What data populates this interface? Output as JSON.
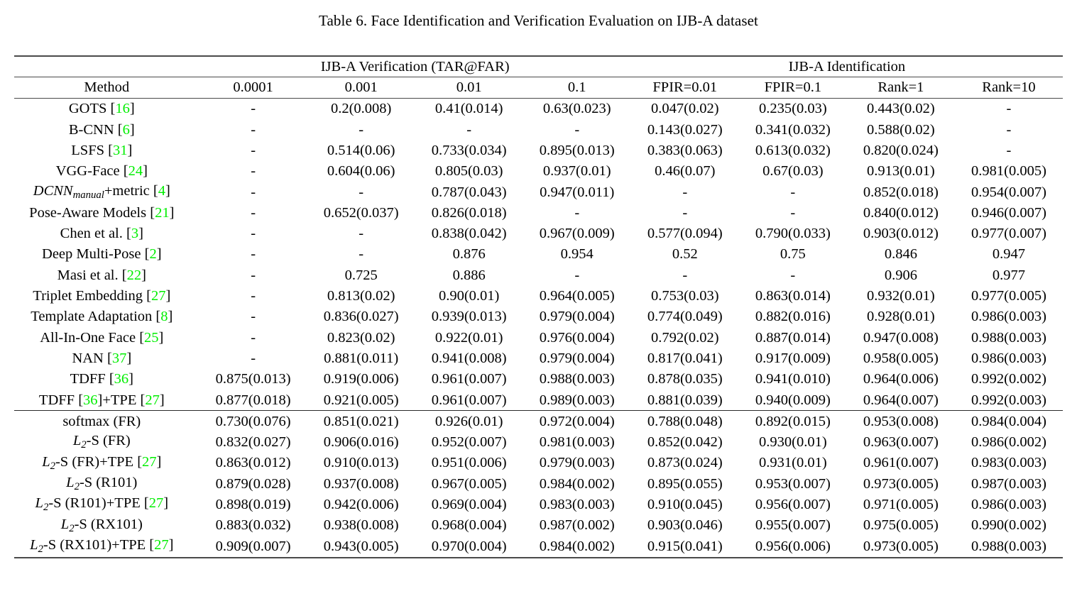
{
  "caption": "Table 6. Face Identification and Verification Evaluation on IJB-A dataset",
  "groups": {
    "verification": "IJB-A Verification (TAR@FAR)",
    "identification": "IJB-A Identification"
  },
  "columns": {
    "method": "Method",
    "far_0001": "0.0001",
    "far_001": "0.001",
    "far_01": "0.01",
    "far_1": "0.1",
    "fpir_001": "FPIR=0.01",
    "fpir_01": "FPIR=0.1",
    "rank1": "Rank=1",
    "rank10": "Rank=10"
  },
  "colors": {
    "citation_green": "#00ee00",
    "rule": "#3a3a3a",
    "text": "#000000"
  },
  "sections": [
    {
      "name": "prior-work",
      "rows": [
        {
          "method_parts": [
            {
              "t": "GOTS ",
              "k": "plain"
            },
            {
              "t": "[",
              "k": "br"
            },
            {
              "t": "16",
              "k": "cite"
            },
            {
              "t": "]",
              "k": "br"
            }
          ],
          "method_text": "GOTS [16]",
          "cells": [
            "-",
            "0.2(0.008)",
            "0.41(0.014)",
            "0.63(0.023)",
            "0.047(0.02)",
            "0.235(0.03)",
            "0.443(0.02)",
            "-"
          ],
          "bold": [
            false,
            false,
            false,
            false,
            false,
            false,
            false,
            false
          ]
        },
        {
          "method_parts": [
            {
              "t": "B-CNN ",
              "k": "plain"
            },
            {
              "t": "[",
              "k": "br"
            },
            {
              "t": "6",
              "k": "cite"
            },
            {
              "t": "]",
              "k": "br"
            }
          ],
          "method_text": "B-CNN [6]",
          "cells": [
            "-",
            "-",
            "-",
            "-",
            "0.143(0.027)",
            "0.341(0.032)",
            "0.588(0.02)",
            "-"
          ],
          "bold": [
            false,
            false,
            false,
            false,
            false,
            false,
            false,
            false
          ]
        },
        {
          "method_parts": [
            {
              "t": "LSFS ",
              "k": "plain"
            },
            {
              "t": "[",
              "k": "br"
            },
            {
              "t": "31",
              "k": "cite"
            },
            {
              "t": "]",
              "k": "br"
            }
          ],
          "method_text": "LSFS [31]",
          "cells": [
            "-",
            "0.514(0.06)",
            "0.733(0.034)",
            "0.895(0.013)",
            "0.383(0.063)",
            "0.613(0.032)",
            "0.820(0.024)",
            "-"
          ],
          "bold": [
            false,
            false,
            false,
            false,
            false,
            false,
            false,
            false
          ]
        },
        {
          "method_parts": [
            {
              "t": "VGG-Face ",
              "k": "plain"
            },
            {
              "t": "[",
              "k": "br"
            },
            {
              "t": "24",
              "k": "cite"
            },
            {
              "t": "]",
              "k": "br"
            }
          ],
          "method_text": "VGG-Face [24]",
          "cells": [
            "-",
            "0.604(0.06)",
            "0.805(0.03)",
            "0.937(0.01)",
            "0.46(0.07)",
            "0.67(0.03)",
            "0.913(0.01)",
            "0.981(0.005)"
          ],
          "bold": [
            false,
            false,
            false,
            false,
            false,
            false,
            false,
            false
          ]
        },
        {
          "method_parts": [
            {
              "t": "DCNN",
              "k": "mi"
            },
            {
              "t": "manual",
              "k": "sub"
            },
            {
              "t": "+metric ",
              "k": "plain"
            },
            {
              "t": "[",
              "k": "br"
            },
            {
              "t": "4",
              "k": "cite"
            },
            {
              "t": "]",
              "k": "br"
            }
          ],
          "method_text": "DCNN_manual+metric [4]",
          "cells": [
            "-",
            "-",
            "0.787(0.043)",
            "0.947(0.011)",
            "-",
            "-",
            "0.852(0.018)",
            "0.954(0.007)"
          ],
          "bold": [
            false,
            false,
            false,
            false,
            false,
            false,
            false,
            false
          ]
        },
        {
          "method_parts": [
            {
              "t": "Pose-Aware Models ",
              "k": "plain"
            },
            {
              "t": "[",
              "k": "br"
            },
            {
              "t": "21",
              "k": "cite"
            },
            {
              "t": "]",
              "k": "br"
            }
          ],
          "method_text": "Pose-Aware Models [21]",
          "cells": [
            "-",
            "0.652(0.037)",
            "0.826(0.018)",
            "-",
            "-",
            "-",
            "0.840(0.012)",
            "0.946(0.007)"
          ],
          "bold": [
            false,
            false,
            false,
            false,
            false,
            false,
            false,
            false
          ]
        },
        {
          "method_parts": [
            {
              "t": "Chen et al. ",
              "k": "plain"
            },
            {
              "t": "[",
              "k": "br"
            },
            {
              "t": "3",
              "k": "cite"
            },
            {
              "t": "]",
              "k": "br"
            }
          ],
          "method_text": "Chen et al. [3]",
          "cells": [
            "-",
            "-",
            "0.838(0.042)",
            "0.967(0.009)",
            "0.577(0.094)",
            "0.790(0.033)",
            "0.903(0.012)",
            "0.977(0.007)"
          ],
          "bold": [
            false,
            false,
            false,
            false,
            false,
            false,
            false,
            false
          ]
        },
        {
          "method_parts": [
            {
              "t": "Deep Multi-Pose ",
              "k": "plain"
            },
            {
              "t": "[",
              "k": "br"
            },
            {
              "t": "2",
              "k": "cite"
            },
            {
              "t": "]",
              "k": "br"
            }
          ],
          "method_text": "Deep Multi-Pose [2]",
          "cells": [
            "-",
            "-",
            "0.876",
            "0.954",
            "0.52",
            "0.75",
            "0.846",
            "0.947"
          ],
          "bold": [
            false,
            false,
            false,
            false,
            false,
            false,
            false,
            false
          ]
        },
        {
          "method_parts": [
            {
              "t": "Masi et al. ",
              "k": "plain"
            },
            {
              "t": "[",
              "k": "br"
            },
            {
              "t": "22",
              "k": "cite"
            },
            {
              "t": "]",
              "k": "br"
            }
          ],
          "method_text": "Masi et al. [22]",
          "cells": [
            "-",
            "0.725",
            "0.886",
            "-",
            "-",
            "-",
            "0.906",
            "0.977"
          ],
          "bold": [
            false,
            false,
            false,
            false,
            false,
            false,
            false,
            false
          ]
        },
        {
          "method_parts": [
            {
              "t": "Triplet Embedding ",
              "k": "plain"
            },
            {
              "t": "[",
              "k": "br"
            },
            {
              "t": "27",
              "k": "cite"
            },
            {
              "t": "]",
              "k": "br"
            }
          ],
          "method_text": "Triplet Embedding [27]",
          "cells": [
            "-",
            "0.813(0.02)",
            "0.90(0.01)",
            "0.964(0.005)",
            "0.753(0.03)",
            "0.863(0.014)",
            "0.932(0.01)",
            "0.977(0.005)"
          ],
          "bold": [
            false,
            false,
            false,
            false,
            false,
            false,
            false,
            false
          ]
        },
        {
          "method_parts": [
            {
              "t": "Template Adaptation ",
              "k": "plain"
            },
            {
              "t": "[",
              "k": "br"
            },
            {
              "t": "8",
              "k": "cite"
            },
            {
              "t": "]",
              "k": "br"
            }
          ],
          "method_text": "Template Adaptation [8]",
          "cells": [
            "-",
            "0.836(0.027)",
            "0.939(0.013)",
            "0.979(0.004)",
            "0.774(0.049)",
            "0.882(0.016)",
            "0.928(0.01)",
            "0.986(0.003)"
          ],
          "bold": [
            false,
            false,
            false,
            false,
            false,
            false,
            false,
            false
          ]
        },
        {
          "method_parts": [
            {
              "t": "All-In-One Face ",
              "k": "plain"
            },
            {
              "t": "[",
              "k": "br"
            },
            {
              "t": "25",
              "k": "cite"
            },
            {
              "t": "]",
              "k": "br"
            }
          ],
          "method_text": "All-In-One Face [25]",
          "cells": [
            "-",
            "0.823(0.02)",
            "0.922(0.01)",
            "0.976(0.004)",
            "0.792(0.02)",
            "0.887(0.014)",
            "0.947(0.008)",
            "0.988(0.003)"
          ],
          "bold": [
            false,
            false,
            false,
            false,
            false,
            false,
            false,
            false
          ]
        },
        {
          "method_parts": [
            {
              "t": "NAN ",
              "k": "plain"
            },
            {
              "t": "[",
              "k": "br"
            },
            {
              "t": "37",
              "k": "cite"
            },
            {
              "t": "]",
              "k": "br"
            }
          ],
          "method_text": "NAN [37]",
          "cells": [
            "-",
            "0.881(0.011)",
            "0.941(0.008)",
            "0.979(0.004)",
            "0.817(0.041)",
            "0.917(0.009)",
            "0.958(0.005)",
            "0.986(0.003)"
          ],
          "bold": [
            false,
            false,
            false,
            false,
            false,
            false,
            false,
            false
          ]
        },
        {
          "method_parts": [
            {
              "t": "TDFF ",
              "k": "plain"
            },
            {
              "t": "[",
              "k": "br"
            },
            {
              "t": "36",
              "k": "cite"
            },
            {
              "t": "]",
              "k": "br"
            }
          ],
          "method_text": "TDFF [36]",
          "cells": [
            "0.875(0.013)",
            "0.919(0.006)",
            "0.961(0.007)",
            "0.988(0.003)",
            "0.878(0.035)",
            "0.941(0.010)",
            "0.964(0.006)",
            "0.992(0.002)"
          ],
          "bold": [
            false,
            false,
            false,
            false,
            false,
            false,
            false,
            true
          ]
        },
        {
          "method_parts": [
            {
              "t": "TDFF ",
              "k": "plain"
            },
            {
              "t": "[",
              "k": "br"
            },
            {
              "t": "36",
              "k": "cite"
            },
            {
              "t": "]",
              "k": "br"
            },
            {
              "t": "+TPE ",
              "k": "plain"
            },
            {
              "t": "[",
              "k": "br"
            },
            {
              "t": "27",
              "k": "cite"
            },
            {
              "t": "]",
              "k": "br"
            }
          ],
          "method_text": "TDFF [36]+TPE [27]",
          "cells": [
            "0.877(0.018)",
            "0.921(0.005)",
            "0.961(0.007)",
            "0.989(0.003)",
            "0.881(0.039)",
            "0.940(0.009)",
            "0.964(0.007)",
            "0.992(0.003)"
          ],
          "bold": [
            false,
            false,
            false,
            true,
            false,
            false,
            false,
            true
          ]
        }
      ]
    },
    {
      "name": "this-work",
      "rows": [
        {
          "method_parts": [
            {
              "t": "softmax (FR)",
              "k": "plain"
            }
          ],
          "method_text": "softmax (FR)",
          "cells": [
            "0.730(0.076)",
            "0.851(0.021)",
            "0.926(0.01)",
            "0.972(0.004)",
            "0.788(0.048)",
            "0.892(0.015)",
            "0.953(0.008)",
            "0.984(0.004)"
          ],
          "bold": [
            false,
            false,
            false,
            false,
            false,
            false,
            false,
            false
          ]
        },
        {
          "method_parts": [
            {
              "t": "L",
              "k": "mi"
            },
            {
              "t": "2",
              "k": "sub"
            },
            {
              "t": "-S (FR)",
              "k": "plain"
            }
          ],
          "method_text": "L2-S (FR)",
          "cells": [
            "0.832(0.027)",
            "0.906(0.016)",
            "0.952(0.007)",
            "0.981(0.003)",
            "0.852(0.042)",
            "0.930(0.01)",
            "0.963(0.007)",
            "0.986(0.002)"
          ],
          "bold": [
            false,
            false,
            false,
            false,
            false,
            false,
            false,
            false
          ]
        },
        {
          "method_parts": [
            {
              "t": "L",
              "k": "mi"
            },
            {
              "t": "2",
              "k": "sub"
            },
            {
              "t": "-S (FR)+TPE ",
              "k": "plain"
            },
            {
              "t": "[",
              "k": "br"
            },
            {
              "t": "27",
              "k": "cite"
            },
            {
              "t": "]",
              "k": "br"
            }
          ],
          "method_text": "L2-S (FR)+TPE [27]",
          "cells": [
            "0.863(0.012)",
            "0.910(0.013)",
            "0.951(0.006)",
            "0.979(0.003)",
            "0.873(0.024)",
            "0.931(0.01)",
            "0.961(0.007)",
            "0.983(0.003)"
          ],
          "bold": [
            false,
            false,
            false,
            false,
            false,
            false,
            false,
            false
          ]
        },
        {
          "method_parts": [
            {
              "t": "L",
              "k": "mi"
            },
            {
              "t": "2",
              "k": "sub"
            },
            {
              "t": "-S (R101)",
              "k": "plain"
            }
          ],
          "method_text": "L2-S (R101)",
          "cells": [
            "0.879(0.028)",
            "0.937(0.008)",
            "0.967(0.005)",
            "0.984(0.002)",
            "0.895(0.055)",
            "0.953(0.007)",
            "0.973(0.005)",
            "0.987(0.003)"
          ],
          "bold": [
            false,
            false,
            false,
            false,
            false,
            false,
            false,
            false
          ]
        },
        {
          "method_parts": [
            {
              "t": "L",
              "k": "mi"
            },
            {
              "t": "2",
              "k": "sub"
            },
            {
              "t": "-S (R101)+TPE ",
              "k": "plain"
            },
            {
              "t": "[",
              "k": "br"
            },
            {
              "t": "27",
              "k": "cite"
            },
            {
              "t": "]",
              "k": "br"
            }
          ],
          "method_text": "L2-S (R101)+TPE [27]",
          "cells": [
            "0.898(0.019)",
            "0.942(0.006)",
            "0.969(0.004)",
            "0.983(0.003)",
            "0.910(0.045)",
            "0.956(0.007)",
            "0.971(0.005)",
            "0.986(0.003)"
          ],
          "bold": [
            false,
            false,
            false,
            false,
            false,
            true,
            false,
            false
          ]
        },
        {
          "method_parts": [
            {
              "t": "L",
              "k": "mi"
            },
            {
              "t": "2",
              "k": "sub"
            },
            {
              "t": "-S (RX101)",
              "k": "plain"
            }
          ],
          "method_text": "L2-S (RX101)",
          "cells": [
            "0.883(0.032)",
            "0.938(0.008)",
            "0.968(0.004)",
            "0.987(0.002)",
            "0.903(0.046)",
            "0.955(0.007)",
            "0.975(0.005)",
            "0.990(0.002)"
          ],
          "bold": [
            false,
            false,
            false,
            false,
            false,
            false,
            true,
            false
          ]
        },
        {
          "method_parts": [
            {
              "t": "L",
              "k": "mi"
            },
            {
              "t": "2",
              "k": "sub"
            },
            {
              "t": "-S (RX101)+TPE ",
              "k": "plain"
            },
            {
              "t": "[",
              "k": "br"
            },
            {
              "t": "27",
              "k": "cite"
            },
            {
              "t": "]",
              "k": "br"
            }
          ],
          "method_text": "L2-S (RX101)+TPE [27]",
          "cells": [
            "0.909(0.007)",
            "0.943(0.005)",
            "0.970(0.004)",
            "0.984(0.002)",
            "0.915(0.041)",
            "0.956(0.006)",
            "0.973(0.005)",
            "0.988(0.003)"
          ],
          "bold": [
            true,
            true,
            true,
            false,
            true,
            true,
            false,
            false
          ]
        }
      ]
    }
  ]
}
